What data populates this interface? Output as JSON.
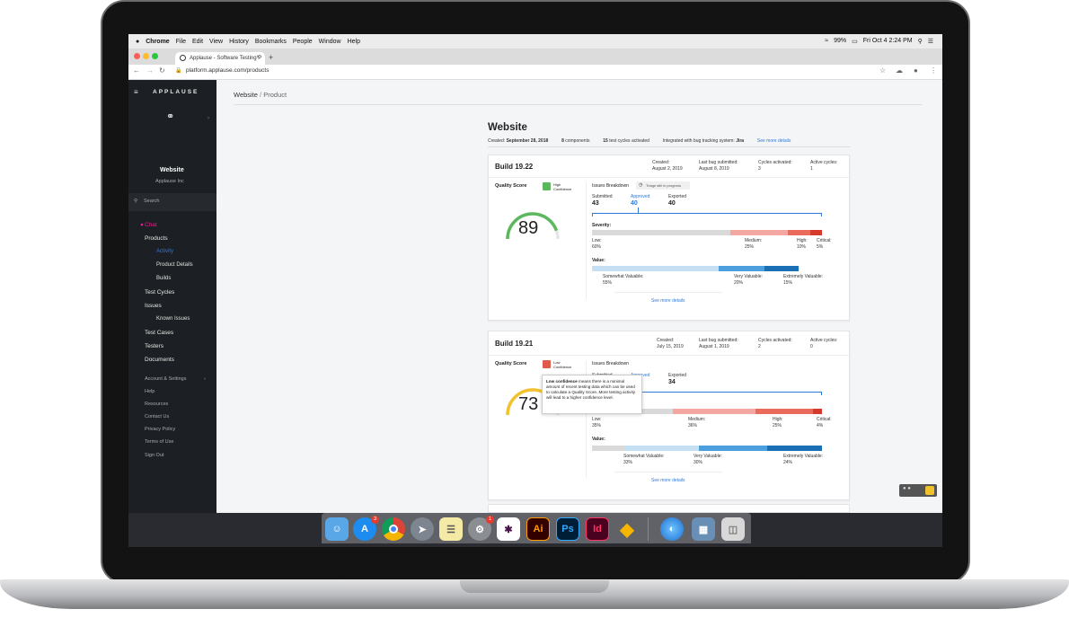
{
  "menubar": {
    "app": "Chrome",
    "items": [
      "File",
      "Edit",
      "View",
      "History",
      "Bookmarks",
      "People",
      "Window",
      "Help"
    ],
    "battery": "99%",
    "clock": "Fri Oct 4  2:24 PM"
  },
  "browser": {
    "tab_title": "Applause - Software Testing P",
    "tab_close": "×",
    "new_tab": "+",
    "url": "platform.applause.com/products"
  },
  "sidebar": {
    "brand": "APPLAUSE",
    "product_name": "Website",
    "company": "Applause Inc",
    "search_placeholder": "Search",
    "chat": "Chat",
    "items": {
      "products": "Products",
      "activity": "Activity",
      "product_details": "Product Details",
      "builds": "Builds",
      "test_cycles": "Test Cycles",
      "issues": "Issues",
      "known_issues": "Known Issues",
      "test_cases": "Test Cases",
      "testers": "Testers",
      "documents": "Documents"
    },
    "footer": {
      "account": "Account & Settings",
      "help": "Help",
      "resources": "Resources",
      "contact": "Contact Us",
      "privacy": "Privacy Policy",
      "terms": "Terms of Use",
      "signout": "Sign Out"
    }
  },
  "breadcrumb": {
    "root": "Website",
    "sep": " / ",
    "current": "Product"
  },
  "page": {
    "title": "Website",
    "created_label": "Created:",
    "created_value": "September 28, 2018",
    "components_count": "8",
    "components_label": "components",
    "cycles_count": "15",
    "cycles_label": "test cycles activated",
    "integration_label": "Integrated with bug tracking system:",
    "integration_value": "Jira",
    "see_more": "See more details"
  },
  "builds": [
    {
      "name": "Build 19.22",
      "created_label": "Created:",
      "created": "August 2, 2019",
      "last_bug_label": "Last bug submitted:",
      "last_bug": "August 8, 2019",
      "cycles_label": "Cycles activated:",
      "cycles": "3",
      "active_label": "Active cycles:",
      "active": "1",
      "quality_label": "Quality Score",
      "confidence": "High",
      "confidence_word": "Confidence",
      "score": "89",
      "score_fraction": 0.89,
      "issues_label": "Issues Breakdown",
      "triage": "Triage still in progress",
      "submitted_label": "Submitted",
      "submitted": "43",
      "approved_label": "Approved",
      "approved": "40",
      "exported_label": "Exported",
      "exported": "40",
      "severity_label": "Severity:",
      "severity": [
        {
          "name": "Low:",
          "pct": "60%",
          "value": 60,
          "color": "#d9d9d9"
        },
        {
          "name": "Medium:",
          "pct": "25%",
          "value": 25,
          "color": "#f3a7a0"
        },
        {
          "name": "High:",
          "pct": "10%",
          "value": 10,
          "color": "#ea6b5c"
        },
        {
          "name": "Critical:",
          "pct": "5%",
          "value": 5,
          "color": "#d63a2c"
        }
      ],
      "value_label": "Value:",
      "valuebars": [
        {
          "name": "Somewhat Valuable:",
          "pct": "55%",
          "value": 55,
          "color": "#c6e0f3"
        },
        {
          "name": "Very Valuable:",
          "pct": "20%",
          "value": 20,
          "color": "#4a9fdc"
        },
        {
          "name": "Extremely Valuable:",
          "pct": "15%",
          "value": 15,
          "color": "#1a6fb5"
        }
      ],
      "see_more": "See more details"
    },
    {
      "name": "Build 19.21",
      "created_label": "Created:",
      "created": "July 15, 2019",
      "last_bug_label": "Last bug submitted:",
      "last_bug": "August 1, 2019",
      "cycles_label": "Cycles activated:",
      "cycles": "2",
      "active_label": "Active cycles:",
      "active": "0",
      "quality_label": "Quality Score",
      "confidence": "Low",
      "confidence_word": "Confidence",
      "score": "73",
      "score_fraction": 0.73,
      "issues_label": "Issues Breakdown",
      "submitted_label": "Submitted",
      "approved_label": "Approved",
      "exported_label": "Exported",
      "exported": "34",
      "tooltip_bold": "Low confidence",
      "tooltip_text": " means there is a minimal amount of recent testing data which can be used to calculate a Quality Score. More testing activity will lead to a higher confidence level.",
      "severity": [
        {
          "name": "Low:",
          "pct": "35%",
          "value": 35,
          "color": "#d9d9d9"
        },
        {
          "name": "Medium:",
          "pct": "36%",
          "value": 36,
          "color": "#f3a7a0"
        },
        {
          "name": "High:",
          "pct": "25%",
          "value": 25,
          "color": "#ea6b5c"
        },
        {
          "name": "Critical:",
          "pct": "4%",
          "value": 4,
          "color": "#d63a2c"
        }
      ],
      "value_label": "Value:",
      "valuebars": [
        {
          "name": "Somewhat Valuable:",
          "pct": "33%",
          "value": 33,
          "color": "#c6e0f3"
        },
        {
          "name": "Very Valuable:",
          "pct": "30%",
          "value": 30,
          "color": "#4a9fdc"
        },
        {
          "name": "Extremely Valuable:",
          "pct": "24%",
          "value": 24,
          "color": "#1a6fb5"
        }
      ],
      "see_more": "See more details"
    }
  ],
  "dock": {
    "appstore_badge": "3",
    "prefs_badge": "1",
    "ai": "Ai",
    "ps": "Ps",
    "id": "Id"
  },
  "colors": {
    "accent": "#2f7ad8",
    "score_high": "#5cb85c",
    "score_mid": "#f2c12e",
    "pink": "#e91e8c"
  }
}
